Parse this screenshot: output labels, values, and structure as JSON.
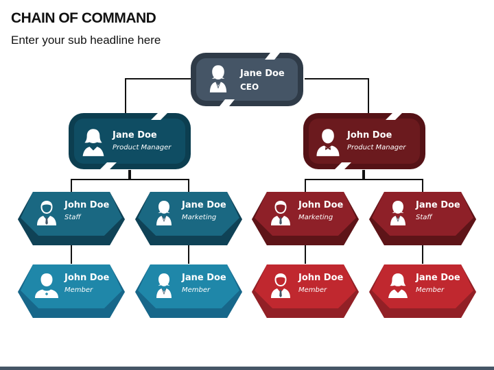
{
  "header": {
    "title": "CHAIN OF COMMAND",
    "subtitle": "Enter your sub headline here"
  },
  "colors": {
    "ceo": "#3f4d5c",
    "teal_dark": "#0f4d63",
    "maroon_dark": "#6b1a1e",
    "teal_mid": "#1a6882",
    "maroon_mid": "#8e2028",
    "teal_light": "#1f87a9",
    "red_light": "#c0282f",
    "footer": "#455566"
  },
  "nodes": {
    "ceo": {
      "name": "Jane Doe",
      "role": "CEO",
      "icon": "female-executive-icon"
    },
    "pm_left": {
      "name": "Jane Doe",
      "role": "Product Manager",
      "icon": "female-icon"
    },
    "pm_right": {
      "name": "John Doe",
      "role": "Product Manager",
      "icon": "male-bowtie-icon"
    },
    "l3_1": {
      "name": "John Doe",
      "role": "Staff",
      "icon": "male-suit-icon"
    },
    "l3_2": {
      "name": "Jane Doe",
      "role": "Marketing",
      "icon": "female-executive-icon"
    },
    "l3_3": {
      "name": "John Doe",
      "role": "Marketing",
      "icon": "male-suit-icon"
    },
    "l3_4": {
      "name": "Jane Doe",
      "role": "Staff",
      "icon": "female-executive-icon"
    },
    "l4_1": {
      "name": "John Doe",
      "role": "Member",
      "icon": "male-priest-icon"
    },
    "l4_2": {
      "name": "Jane Doe",
      "role": "Member",
      "icon": "female-executive-icon"
    },
    "l4_3": {
      "name": "John Doe",
      "role": "Member",
      "icon": "male-suit-icon"
    },
    "l4_4": {
      "name": "Jane Doe",
      "role": "Member",
      "icon": "female-icon"
    }
  }
}
